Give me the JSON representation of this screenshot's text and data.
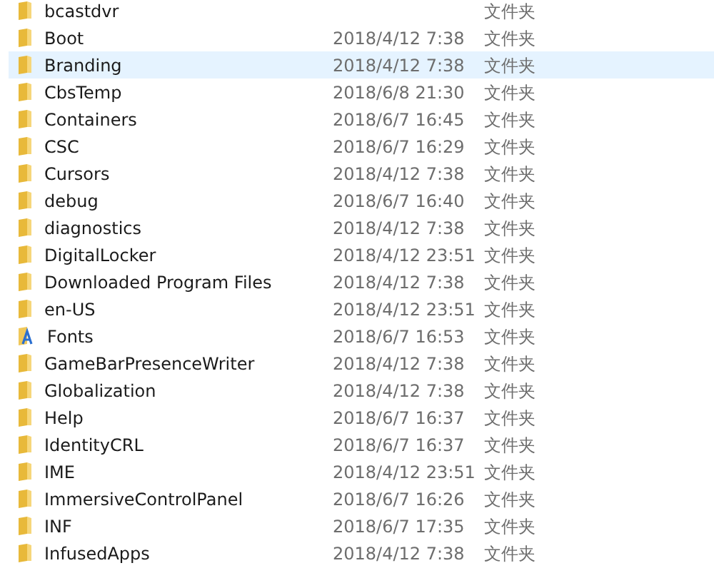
{
  "rows": [
    {
      "name": "bcastdvr",
      "type": "文件夹",
      "kind": "folder",
      "selected": false
    },
    {
      "name": "Boot",
      "modified": "2018/4/12 7:38",
      "type": "文件夹",
      "kind": "folder",
      "selected": false
    },
    {
      "name": "Branding",
      "modified": "2018/4/12 7:38",
      "type": "文件夹",
      "kind": "folder",
      "selected": true
    },
    {
      "name": "CbsTemp",
      "modified": "2018/6/8 21:30",
      "type": "文件夹",
      "kind": "folder",
      "selected": false
    },
    {
      "name": "Containers",
      "modified": "2018/6/7 16:45",
      "type": "文件夹",
      "kind": "folder",
      "selected": false
    },
    {
      "name": "CSC",
      "modified": "2018/6/7 16:29",
      "type": "文件夹",
      "kind": "folder",
      "selected": false
    },
    {
      "name": "Cursors",
      "modified": "2018/4/12 7:38",
      "type": "文件夹",
      "kind": "folder",
      "selected": false
    },
    {
      "name": "debug",
      "modified": "2018/6/7 16:40",
      "type": "文件夹",
      "kind": "folder",
      "selected": false
    },
    {
      "name": "diagnostics",
      "modified": "2018/4/12 7:38",
      "type": "文件夹",
      "kind": "folder",
      "selected": false
    },
    {
      "name": "DigitalLocker",
      "modified": "2018/4/12 23:51",
      "type": "文件夹",
      "kind": "folder",
      "selected": false
    },
    {
      "name": "Downloaded Program Files",
      "modified": "2018/4/12 7:38",
      "type": "文件夹",
      "kind": "folder",
      "selected": false
    },
    {
      "name": "en-US",
      "modified": "2018/4/12 23:51",
      "type": "文件夹",
      "kind": "folder",
      "selected": false
    },
    {
      "name": "Fonts",
      "modified": "2018/6/7 16:53",
      "type": "文件夹",
      "kind": "fonts",
      "selected": false
    },
    {
      "name": "GameBarPresenceWriter",
      "modified": "2018/4/12 7:38",
      "type": "文件夹",
      "kind": "folder",
      "selected": false
    },
    {
      "name": "Globalization",
      "modified": "2018/4/12 7:38",
      "type": "文件夹",
      "kind": "folder",
      "selected": false
    },
    {
      "name": "Help",
      "modified": "2018/6/7 16:37",
      "type": "文件夹",
      "kind": "folder",
      "selected": false
    },
    {
      "name": "IdentityCRL",
      "modified": "2018/6/7 16:37",
      "type": "文件夹",
      "kind": "folder",
      "selected": false
    },
    {
      "name": "IME",
      "modified": "2018/4/12 23:51",
      "type": "文件夹",
      "kind": "folder",
      "selected": false
    },
    {
      "name": "ImmersiveControlPanel",
      "modified": "2018/6/7 16:26",
      "type": "文件夹",
      "kind": "folder",
      "selected": false
    },
    {
      "name": "INF",
      "modified": "2018/6/7 17:35",
      "type": "文件夹",
      "kind": "folder",
      "selected": false
    },
    {
      "name": "InfusedApps",
      "modified": "2018/4/12 7:38",
      "type": "文件夹",
      "kind": "folder",
      "selected": false
    }
  ]
}
